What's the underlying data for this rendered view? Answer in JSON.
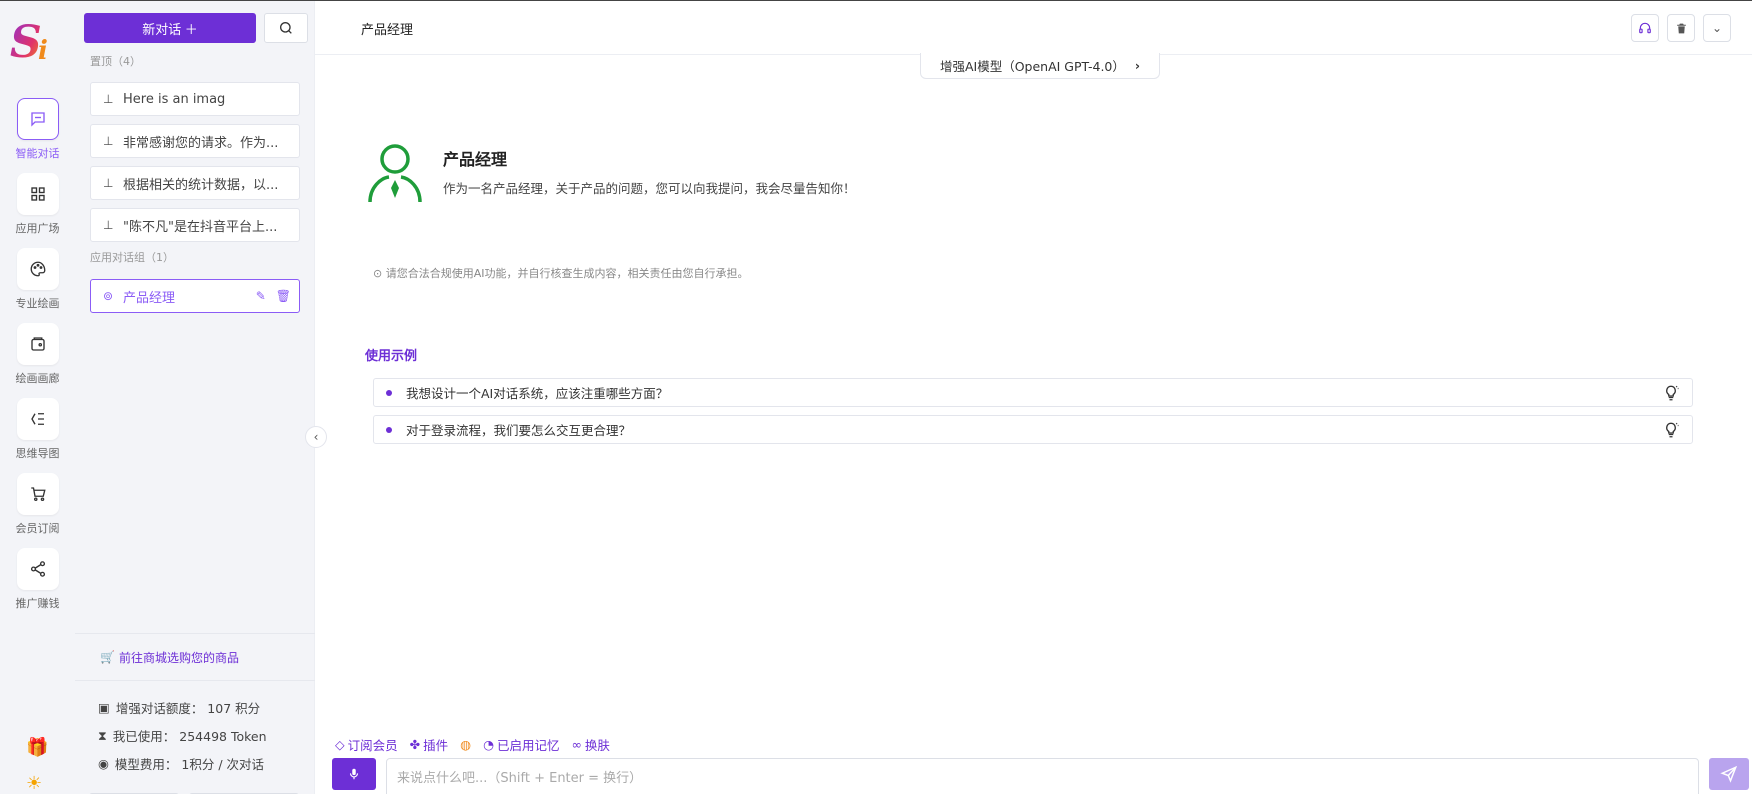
{
  "app": {
    "logo_text": "Si"
  },
  "nav": [
    {
      "label": "智能对话",
      "icon": "chat-icon",
      "active": true
    },
    {
      "label": "应用广场",
      "icon": "grid-icon"
    },
    {
      "label": "专业绘画",
      "icon": "palette-icon"
    },
    {
      "label": "绘画画廊",
      "icon": "gallery-icon"
    },
    {
      "label": "思维导图",
      "icon": "mindmap-icon"
    },
    {
      "label": "会员订阅",
      "icon": "cart-icon"
    },
    {
      "label": "推广赚钱",
      "icon": "share-icon"
    }
  ],
  "rail_bottom": {
    "gift": "🎁",
    "theme": "☀"
  },
  "sidebar": {
    "new_chat_label": "新对话 ＋",
    "pinned_label": "置顶（4）",
    "pinned": [
      "Here is an imag",
      "非常感谢您的请求。作为...",
      "根据相关的统计数据，以...",
      "\"陈不凡\"是在抖音平台上..."
    ],
    "app_group_label": "应用对话组（1）",
    "app_group": [
      "产品经理"
    ],
    "shop_link": "前往商城选购您的商品",
    "quota": [
      {
        "icon": "wallet-icon",
        "text": "增强对话额度： 107 积分"
      },
      {
        "icon": "hourglass-icon",
        "text": "我已使用： 254498 Token"
      },
      {
        "icon": "coin-icon",
        "text": "模型费用： 1积分 / 次对话"
      }
    ]
  },
  "header": {
    "title": "产品经理",
    "model": "增强AI模型（OpenAI GPT-4.0）"
  },
  "agent": {
    "name": "产品经理",
    "description": "作为一名产品经理，关于产品的问题，您可以向我提问，我会尽量告知你！"
  },
  "disclaimer": "⊙ 请您合法合规使用AI功能，并自行核查生成内容，相关责任由您自行承担。",
  "examples_title": "使用示例",
  "examples": [
    "我想设计一个AI对话系统，应该注重哪些方面？",
    "对于登录流程，我们要怎么交互更合理？"
  ],
  "toolbar": {
    "subscribe": "订阅会员",
    "plugins": "插件",
    "memory": "已启用记忆",
    "skin": "换肤"
  },
  "input": {
    "placeholder": "来说点什么吧...（Shift + Enter = 换行）"
  },
  "colors": {
    "accent": "#6d2fd6",
    "accent_light": "#8b5cf6",
    "agent_green": "#1f9d3a"
  }
}
